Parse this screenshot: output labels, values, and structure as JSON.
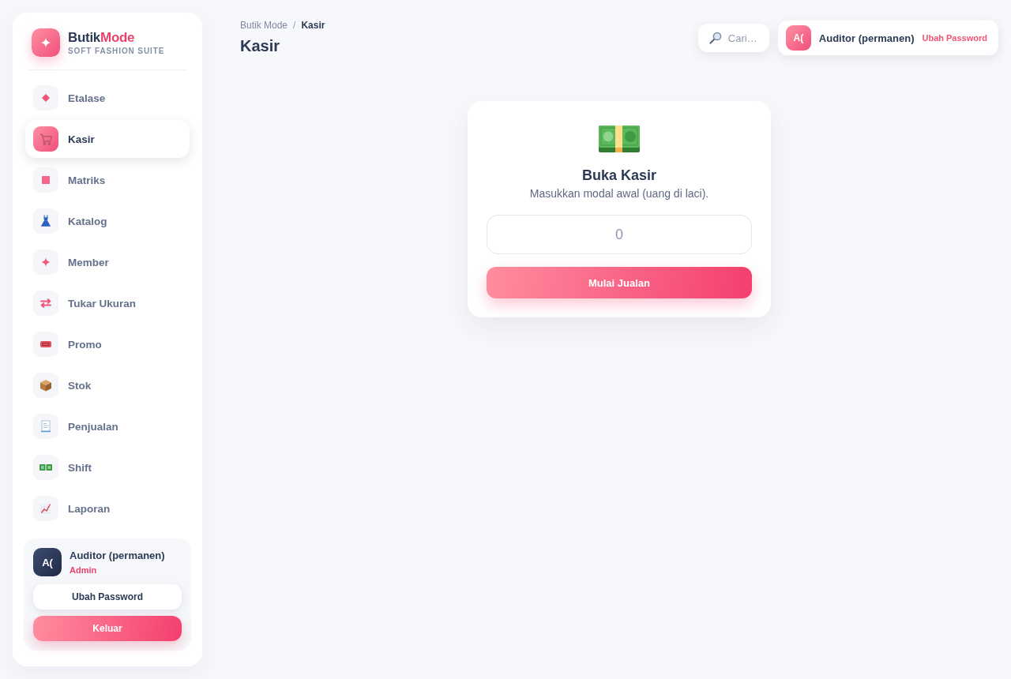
{
  "sidebar": {
    "brand": {
      "name": "Butik",
      "accent": "Mode",
      "tagline": "SOFT FASHION SUITE"
    },
    "nav": [
      {
        "label": "Etalase",
        "selected": false
      },
      {
        "label": "Kasir",
        "selected": true
      },
      {
        "label": "Matriks",
        "selected": false
      },
      {
        "label": "Katalog",
        "selected": false
      },
      {
        "label": "Member",
        "selected": false
      },
      {
        "label": "Tukar Ukuran",
        "selected": false
      },
      {
        "label": "Promo",
        "selected": false
      },
      {
        "label": "Stok",
        "selected": false
      },
      {
        "label": "Penjualan",
        "selected": false
      },
      {
        "label": "Shift",
        "selected": false
      },
      {
        "label": "Laporan",
        "selected": false
      }
    ],
    "user": {
      "initials": "A(",
      "name": "Auditor (permanen)",
      "role": "Admin"
    },
    "buttons": [
      {
        "label": "Ubah Password",
        "kind": "secondary"
      },
      {
        "label": "Keluar",
        "kind": "primary"
      }
    ]
  },
  "header": {
    "breadcrumb": [
      {
        "label": "Butik Mode",
        "current": false
      },
      {
        "label": "Kasir",
        "current": true
      }
    ],
    "separator": "/",
    "title": "Kasir",
    "search": {
      "placeholder": "Cari…"
    },
    "user": {
      "initials": "A(",
      "name": "Auditor (permanen)",
      "link": "Ubah Password"
    }
  },
  "open_register": {
    "title": "Buka Kasir",
    "subtitle": "Masukkan modal awal (uang di laci).",
    "amount": {
      "placeholder": "0"
    },
    "button": "Mulai Jualan"
  }
}
